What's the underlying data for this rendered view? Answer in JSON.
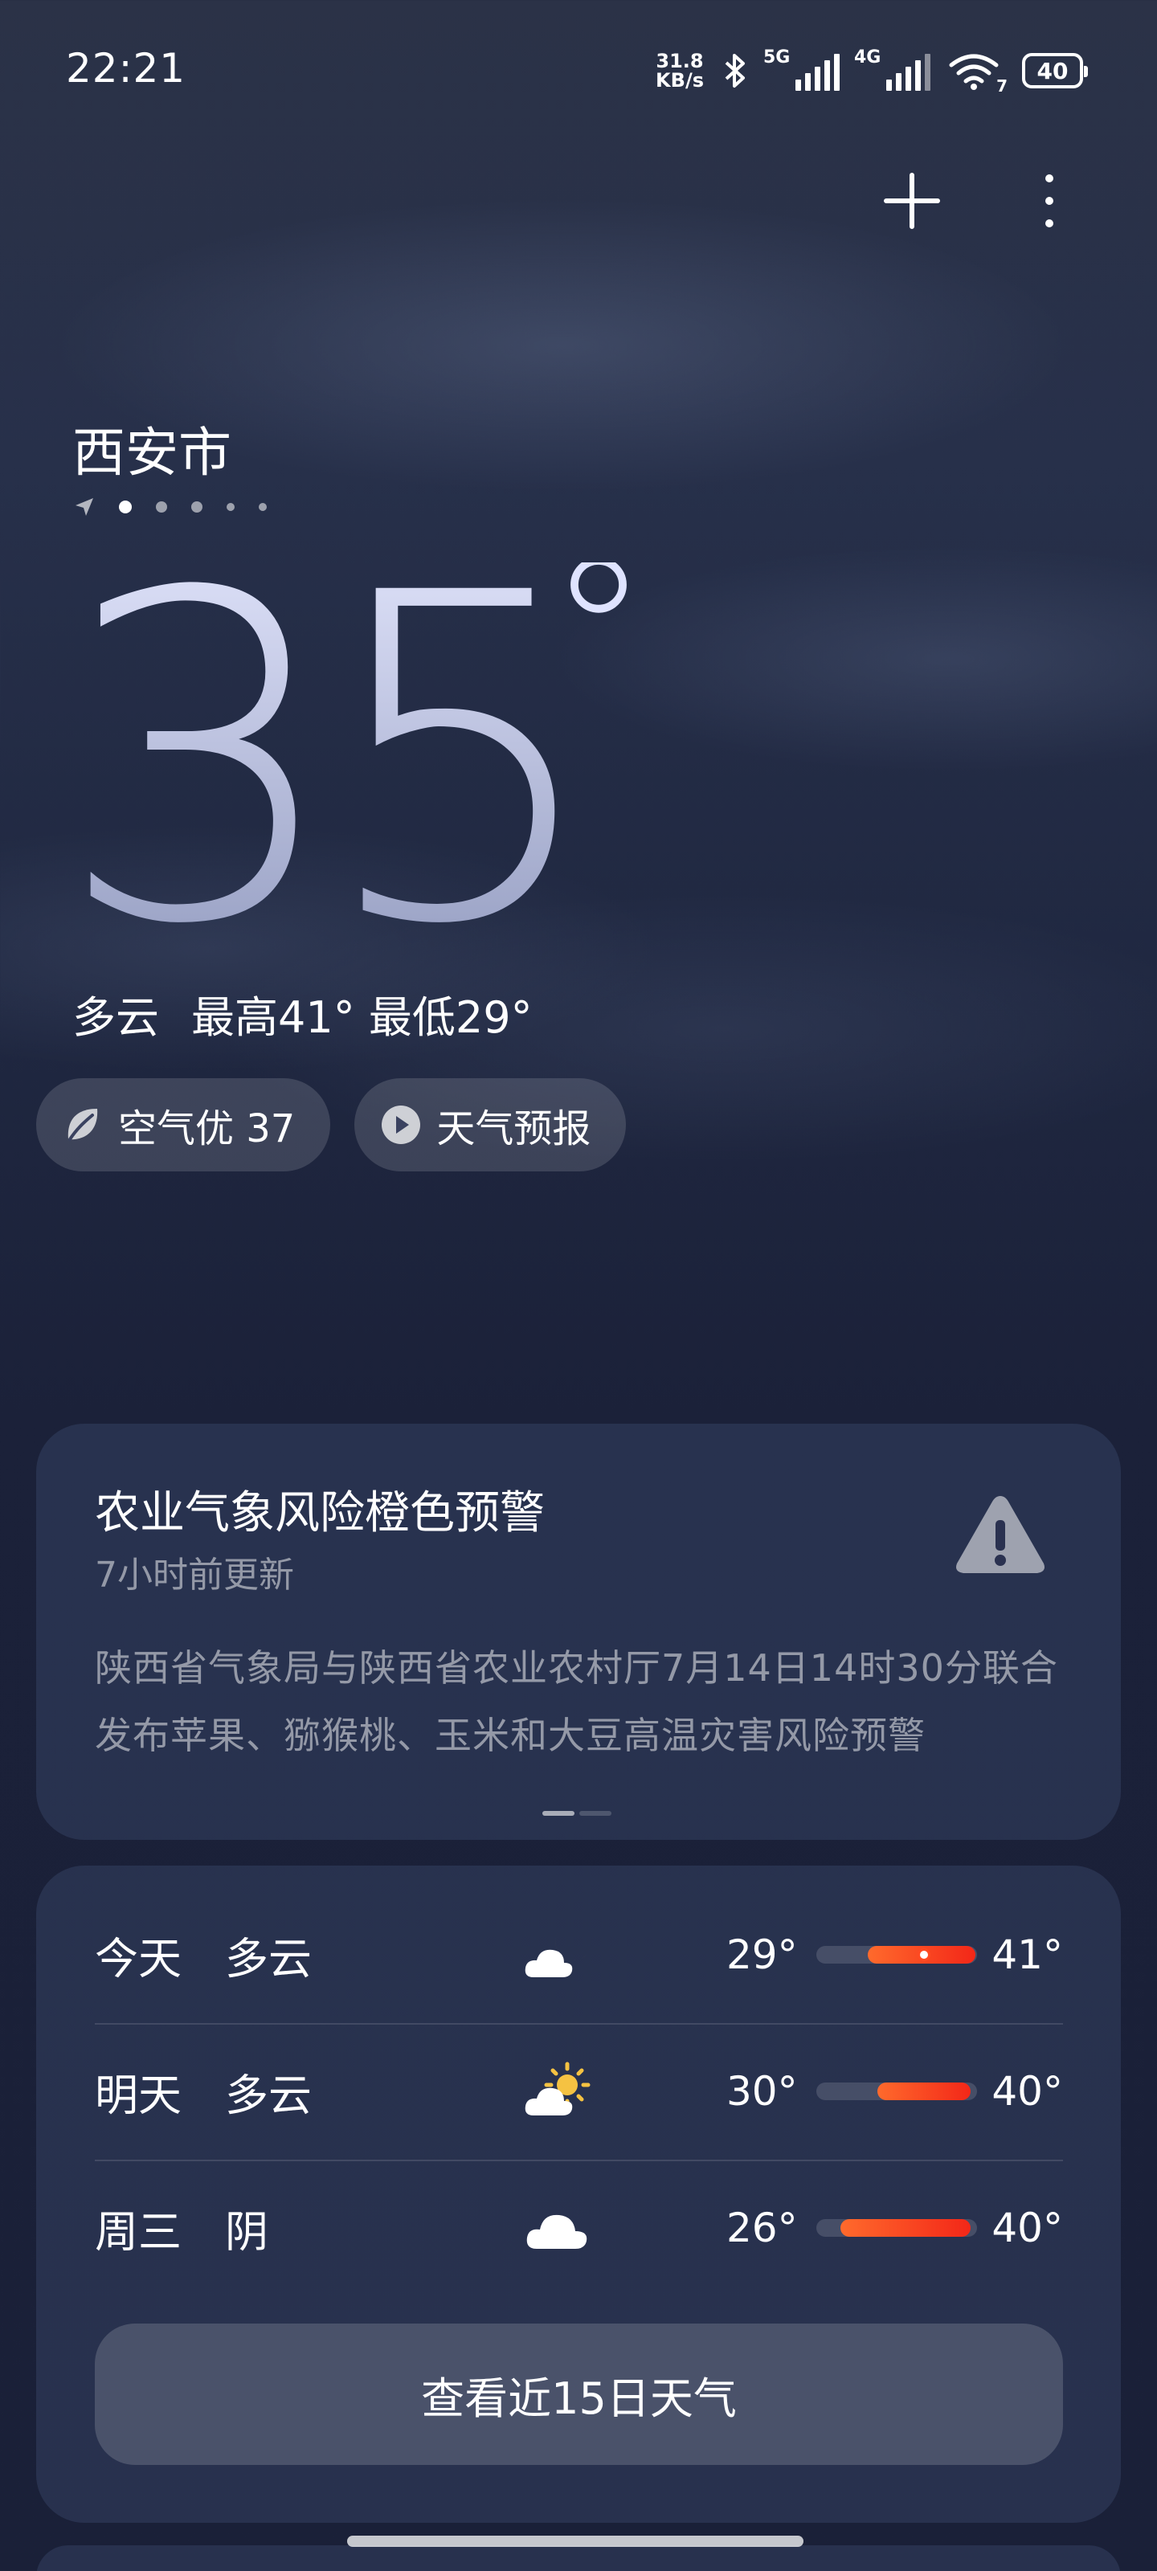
{
  "status_bar": {
    "time": "22:21",
    "net_speed_value": "31.8",
    "net_speed_unit": "KB/s",
    "sim1_label": "5G",
    "sim2_label": "4G",
    "wifi_label": "7",
    "battery": "40"
  },
  "location": {
    "city": "西安市"
  },
  "current": {
    "temperature": "35",
    "degree_symbol": "°",
    "condition": "多云",
    "high_low": "最高41° 最低29°"
  },
  "chips": {
    "air_quality": "空气优 37",
    "forecast_video": "天气预报"
  },
  "alert": {
    "title": "农业气象风险橙色预警",
    "updated": "7小时前更新",
    "body": "陕西省气象局与陕西省农业农村厅7月14日14时30分联合发布苹果、猕猴桃、玉米和大豆高温灾害风险预警"
  },
  "forecast": {
    "rows": [
      {
        "day": "今天",
        "condition": "多云",
        "icon": "partly-cloudy-night-icon",
        "low": "29°",
        "high": "41°"
      },
      {
        "day": "明天",
        "condition": "多云",
        "icon": "partly-cloudy-day-icon",
        "low": "30°",
        "high": "40°"
      },
      {
        "day": "周三",
        "condition": "阴",
        "icon": "cloud-icon",
        "low": "26°",
        "high": "40°"
      }
    ],
    "button_label": "查看近15日天气"
  },
  "colors": {
    "accent_orange": "#ff6a2c",
    "accent_red": "#f32718"
  }
}
